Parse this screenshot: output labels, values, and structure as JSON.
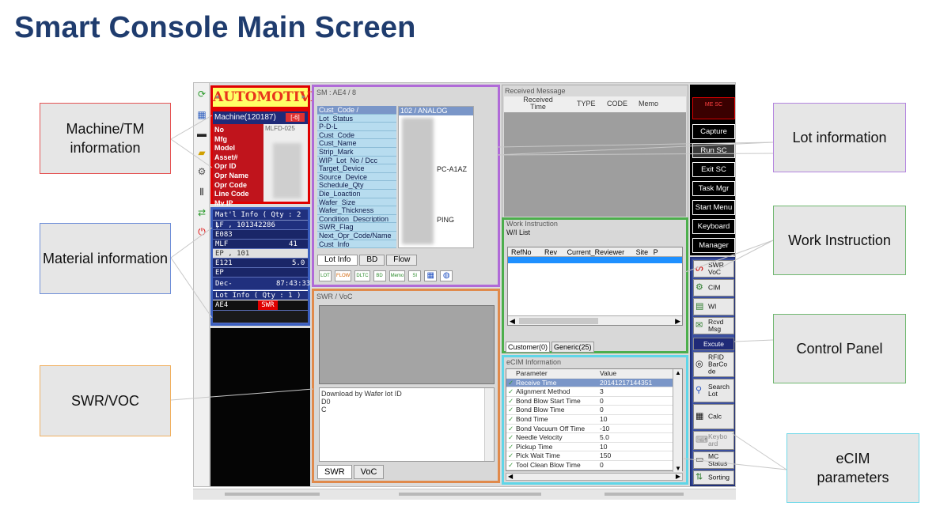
{
  "slide_title": "Smart Console Main Screen",
  "callouts": {
    "machine": "Machine/TM information",
    "material": "Material information",
    "swr_voc": "SWR/VOC",
    "lot": "Lot information",
    "work_instruction": "Work Instruction",
    "control_panel": "Control Panel",
    "ecim": "eCIM parameters"
  },
  "machine": {
    "banner": "AUTOMOTIVE",
    "header": "Machine(120187)",
    "header_badge": "[-6]",
    "no_value": "MLFD-025",
    "labels": [
      "No",
      "Mfg",
      "Model",
      "Asset#",
      "Opr ID",
      "Opr Name",
      "Opr Code",
      "Line Code",
      "Mv IP"
    ]
  },
  "material": {
    "title": "Mat'l Info ( Qty : 2 )",
    "rows": [
      "LF , 101342286",
      "E083",
      "MLF",
      "EP , 101",
      "E121",
      "EP",
      "Dec-"
    ],
    "row_suffix_1": "41",
    "row_suffix_2": "5.0",
    "row_suffix_3": "87:43:33",
    "lot_title": "Lot Info ( Qty : 1 )",
    "lot_name": "AE4",
    "lot_badge": "SWR"
  },
  "sm_panel": {
    "caption": "SM : AE4 / 8",
    "fields": [
      "Cust_Code /",
      "Lot_Status",
      "P-D-L",
      "Cust_Code",
      "Cust_Name",
      "Strip_Mark",
      "WIP_Lot_No / Dcc",
      "Target_Device",
      "Source_Device",
      "Schedule_Qty",
      "Die_Loaction",
      "Wafer_Size",
      "Wafer_Thickness",
      "Condition_Description",
      "SWR_Flag",
      "Next_Opr_Code/Name",
      "Cust_Info"
    ],
    "value_header": "102 / ANALOG",
    "value_target": "PC-A1AZ",
    "value_condition": "PING",
    "tabs": [
      "Lot Info",
      "BD",
      "Flow"
    ],
    "tool_icons": [
      "LOT",
      "FLOW",
      "DLTC",
      "BD",
      "Memo",
      "SI",
      "grid",
      "globe"
    ]
  },
  "swr_panel": {
    "caption": "SWR / VoC",
    "text": "Download by Wafer lot ID",
    "text_line2": "D0",
    "text_line3": "C",
    "tabs": [
      "SWR",
      "VoC"
    ]
  },
  "received": {
    "caption": "Received Message",
    "columns": [
      "Received Time",
      "TYPE",
      "CODE",
      "Memo"
    ]
  },
  "work_instruction": {
    "caption": "Work Instruction",
    "subcaption": "W/I List",
    "columns": [
      "RefNo",
      "Rev",
      "Current_Reviewer",
      "Site",
      "P"
    ],
    "tabs": [
      "Customer(0)",
      "Generic(25)"
    ]
  },
  "ecim": {
    "caption": "eCIM Information",
    "headers": [
      "Parameter",
      "Value"
    ],
    "rows": [
      {
        "p": "Receive Time",
        "v": "20141217144351"
      },
      {
        "p": "Alignment Method",
        "v": "3"
      },
      {
        "p": "Bond Blow Start Time",
        "v": "0"
      },
      {
        "p": "Bond Blow Time",
        "v": "0"
      },
      {
        "p": "Bond Time",
        "v": "10"
      },
      {
        "p": "Bond Vacuum Off Time",
        "v": "-10"
      },
      {
        "p": "Needle Velocity",
        "v": "5.0"
      },
      {
        "p": "Pickup Time",
        "v": "10"
      },
      {
        "p": "Pick Wait Time",
        "v": "150"
      },
      {
        "p": "Tool Clean Blow Time",
        "v": "0"
      }
    ]
  },
  "black_buttons": {
    "mesc": "ME SC",
    "capture": "Capture",
    "run_sc": "Run SC",
    "exit_sc": "Exit SC",
    "task_mgr": "Task Mgr",
    "start_menu": "Start Menu",
    "keyboard": "Keyboard",
    "manager": "Manager"
  },
  "control_panel": {
    "swr_voc": "SWR VoC",
    "cim": "CIM",
    "wi": "WI",
    "rcvd_msg": "Rcvd Msg",
    "excute": "Excute",
    "rfid": "RFID BarCo de",
    "search_lot": "Search Lot",
    "calc": "Calc",
    "keyboard": "Keybo ard",
    "mc_status": "MC Status",
    "sorting": "Sorting"
  },
  "colors": {
    "title": "#1f3c6e",
    "machine_border": "#e00000",
    "material_border": "#3b5fc0",
    "sm_border": "#b06ad8",
    "swr_border": "#e08a4c",
    "wi_border": "#4cae4c",
    "ecim_border": "#5fd6e8",
    "ctrl_border": "#1f2f78"
  }
}
